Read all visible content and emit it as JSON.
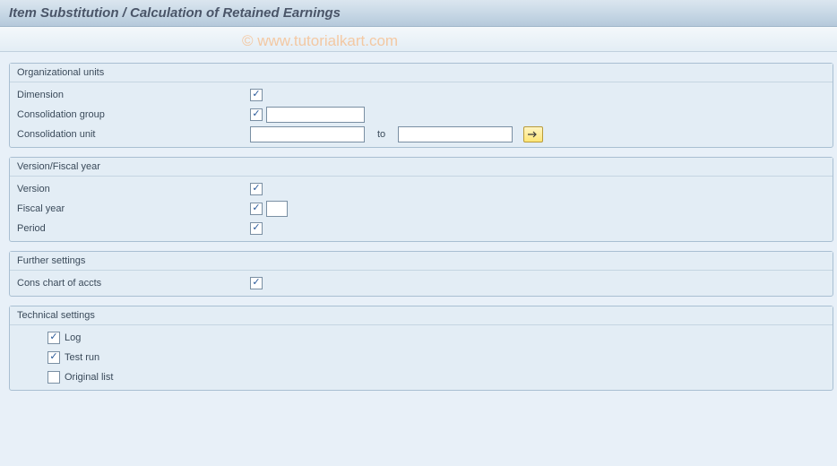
{
  "header": {
    "title": "Item Substitution / Calculation of Retained Earnings"
  },
  "watermark": "© www.tutorialkart.com",
  "groups": {
    "org": {
      "title": "Organizational units",
      "dimension_label": "Dimension",
      "cons_group_label": "Consolidation group",
      "cons_unit_label": "Consolidation unit",
      "to_label": "to",
      "cons_group_value": "",
      "cons_unit_from": "",
      "cons_unit_to": ""
    },
    "version": {
      "title": "Version/Fiscal year",
      "version_label": "Version",
      "fiscal_year_label": "Fiscal year",
      "period_label": "Period",
      "fiscal_year_value": ""
    },
    "further": {
      "title": "Further settings",
      "cons_chart_label": "Cons chart of accts"
    },
    "tech": {
      "title": "Technical settings",
      "log_label": "Log",
      "test_run_label": "Test run",
      "original_list_label": "Original list"
    }
  }
}
